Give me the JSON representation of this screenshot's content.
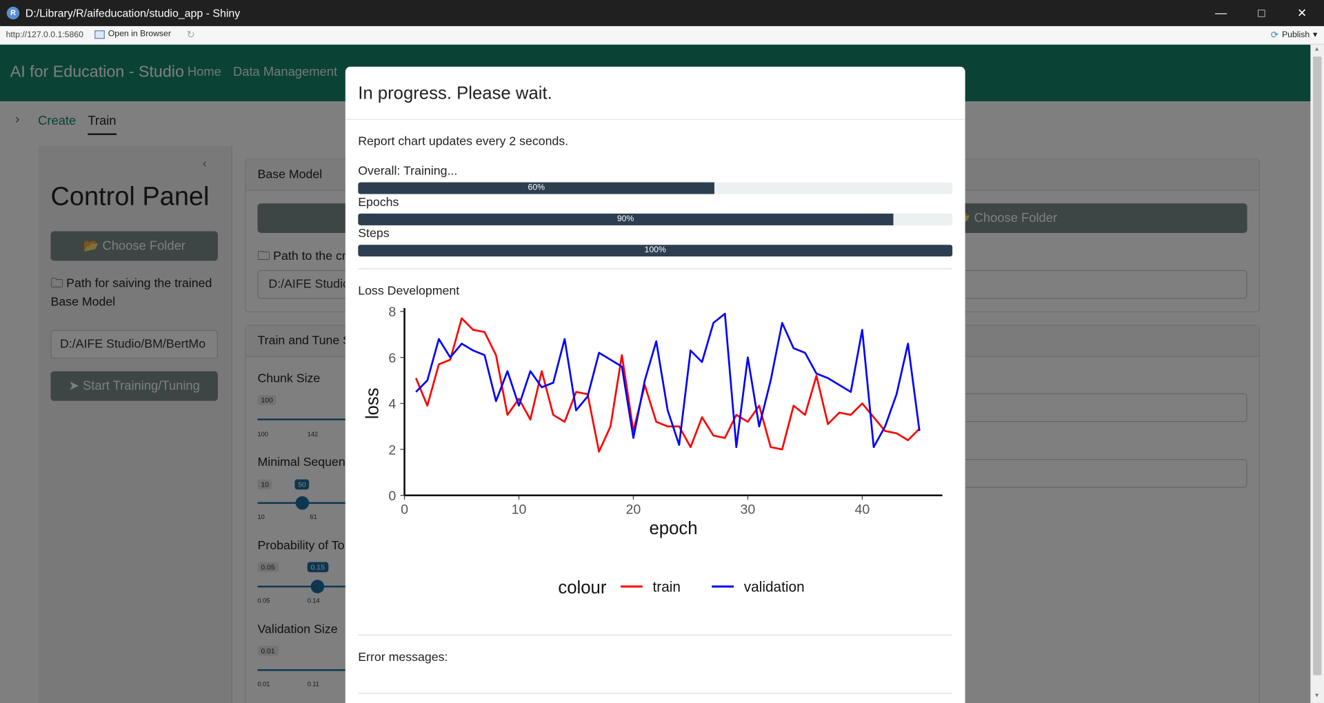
{
  "window": {
    "title": "D:/Library/R/aifeducation/studio_app - Shiny",
    "app_icon_letter": "R",
    "minimize_icon": "minimize-icon",
    "maximize_icon": "maximize-icon",
    "close_icon": "close-icon"
  },
  "viewer_bar": {
    "url": "http://127.0.0.1:5860",
    "open_in_browser": "Open in Browser",
    "publish": "Publish"
  },
  "navbar": {
    "brand": "AI for Education - Studio",
    "links": [
      "Home",
      "Data Management"
    ],
    "bg_color": "#17856c"
  },
  "subtabs": [
    "Create",
    "Train"
  ],
  "sidebar": {
    "title": "Control Panel",
    "choose_folder": "Choose Folder",
    "path_label": "Path for saiving the trained Base Model",
    "path_value": "D:/AIFE Studio/BM/BertMo",
    "start_button": "Start Training/Tuning"
  },
  "base_model_card": {
    "header": "Base Model",
    "choose_folder": "Choose Folder",
    "path_label": "Path to the cr",
    "path_value": "D:/AIFE Studio"
  },
  "train_card": {
    "header": "Train and Tune S",
    "chunk_size": {
      "label": "Chunk Size",
      "min": "100",
      "ticks": [
        "100",
        "142"
      ]
    },
    "min_seq": {
      "label": "Minimal Sequen",
      "min": "10",
      "value": "50",
      "ticks": [
        "10",
        "61"
      ]
    },
    "prob": {
      "label": "Probability of To",
      "min": "0.05",
      "value": "0.15",
      "ticks": [
        "0.05",
        "0.14"
      ]
    },
    "val_size": {
      "label": "Validation Size",
      "min": "0.01",
      "ticks": [
        "0.01",
        "0.11"
      ]
    }
  },
  "modal": {
    "title": "In progress. Please wait.",
    "note": "Report chart updates every 2 seconds.",
    "progress": [
      {
        "label": "Overall: Training...",
        "percent": 60,
        "text": "60%"
      },
      {
        "label": "Epochs",
        "percent": 90,
        "text": "90%"
      },
      {
        "label": "Steps",
        "percent": 100,
        "text": "100%"
      }
    ],
    "loss_title": "Loss Development",
    "errors_label": "Error messages:"
  },
  "chart_data": {
    "type": "line",
    "title": "",
    "xlabel": "epoch",
    "ylabel": "loss",
    "xlim": [
      0,
      47
    ],
    "ylim": [
      0,
      8
    ],
    "xticks": [
      0,
      10,
      20,
      30,
      40
    ],
    "yticks": [
      0,
      2,
      4,
      6,
      8
    ],
    "legend_title": "colour",
    "legend_position": "bottom",
    "x": [
      1,
      2,
      3,
      4,
      5,
      6,
      7,
      8,
      9,
      10,
      11,
      12,
      13,
      14,
      15,
      16,
      17,
      18,
      19,
      20,
      21,
      22,
      23,
      24,
      25,
      26,
      27,
      28,
      29,
      30,
      31,
      32,
      33,
      34,
      35,
      36,
      37,
      38,
      39,
      40,
      41,
      42,
      43,
      44,
      45
    ],
    "series": [
      {
        "name": "train",
        "color": "#ff0000",
        "values": [
          5.1,
          3.9,
          5.7,
          5.9,
          7.7,
          7.2,
          7.1,
          6.1,
          3.5,
          4.2,
          3.3,
          5.4,
          3.5,
          3.2,
          4.5,
          4.4,
          1.9,
          3.0,
          6.1,
          2.8,
          4.8,
          3.2,
          3.0,
          3.0,
          2.1,
          3.4,
          2.6,
          2.5,
          3.5,
          3.2,
          3.9,
          2.1,
          2.0,
          3.9,
          3.5,
          5.2,
          3.1,
          3.6,
          3.5,
          4.0,
          3.4,
          2.8,
          2.7,
          2.4,
          2.9
        ]
      },
      {
        "name": "validation",
        "color": "#0000ff",
        "values": [
          4.5,
          5.0,
          6.8,
          6.0,
          6.6,
          6.3,
          6.1,
          4.1,
          5.4,
          3.9,
          5.4,
          4.7,
          4.9,
          6.8,
          3.7,
          4.3,
          6.2,
          5.9,
          5.6,
          2.5,
          5.0,
          6.7,
          3.7,
          2.2,
          6.3,
          5.8,
          7.5,
          7.9,
          2.1,
          6.0,
          3.0,
          5.0,
          7.5,
          6.4,
          6.2,
          5.3,
          5.1,
          4.8,
          4.5,
          7.2,
          2.1,
          3.0,
          4.4,
          6.6,
          2.8
        ]
      }
    ]
  }
}
